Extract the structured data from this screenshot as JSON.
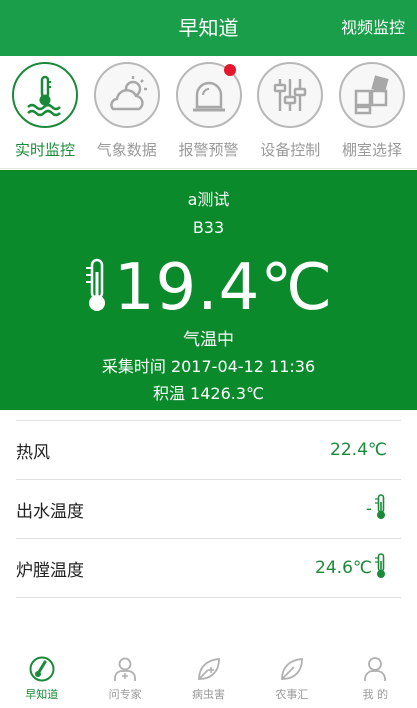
{
  "header": {
    "title": "早知道",
    "right_button": "视频监控"
  },
  "iconbar": {
    "items": [
      {
        "label": "实时监控",
        "icon": "thermometer-water-icon",
        "active": true
      },
      {
        "label": "气象数据",
        "icon": "cloud-sun-icon",
        "active": false
      },
      {
        "label": "报警预警",
        "icon": "alarm-siren-icon",
        "active": false,
        "badge": true
      },
      {
        "label": "设备控制",
        "icon": "sliders-icon",
        "active": false
      },
      {
        "label": "棚室选择",
        "icon": "grid-blocks-icon",
        "active": false
      }
    ]
  },
  "hero": {
    "name": "a测试",
    "code": "B33",
    "temperature": "19.4℃",
    "status": "气温中",
    "time_label": "采集时间 2017-04-12 11:36",
    "accumulated": "积温 1426.3℃"
  },
  "list": [
    {
      "key": "热风",
      "value": "22.4℃",
      "therm": false
    },
    {
      "key": "出水温度",
      "value": "-",
      "therm": true
    },
    {
      "key": "炉膛温度",
      "value": "24.6℃",
      "therm": true
    }
  ],
  "tabbar": [
    {
      "label": "早知道",
      "icon": "thermometer-icon",
      "active": true
    },
    {
      "label": "问专家",
      "icon": "doctor-icon",
      "active": false
    },
    {
      "label": "病虫害",
      "icon": "leaf-plus-icon",
      "active": false
    },
    {
      "label": "农事汇",
      "icon": "leaf-icon",
      "active": false
    },
    {
      "label": "我 的",
      "icon": "user-icon",
      "active": false
    }
  ],
  "colors": {
    "primary": "#1a9e4a",
    "hero": "#0b8a2c",
    "accent": "#1a8a3a",
    "alert": "#e6162d"
  }
}
